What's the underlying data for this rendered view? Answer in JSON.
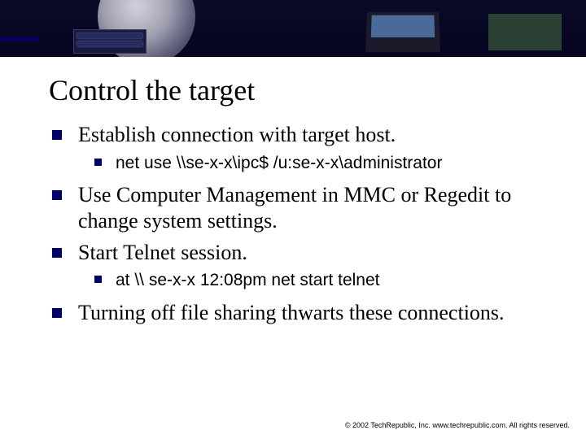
{
  "title": "Control the target",
  "bullets": {
    "b1": "Establish connection with target host.",
    "b1_sub": "net use \\\\se-x-x\\ipc$ /u:se-x-x\\administrator",
    "b2": "Use Computer Management in MMC or Regedit to change system settings.",
    "b3": "Start Telnet session.",
    "b3_sub": "at \\\\ se-x-x 12:08pm net start telnet",
    "b4": "Turning off file sharing thwarts these connections."
  },
  "footer": "© 2002 TechRepublic, Inc. www.techrepublic.com. All rights reserved."
}
